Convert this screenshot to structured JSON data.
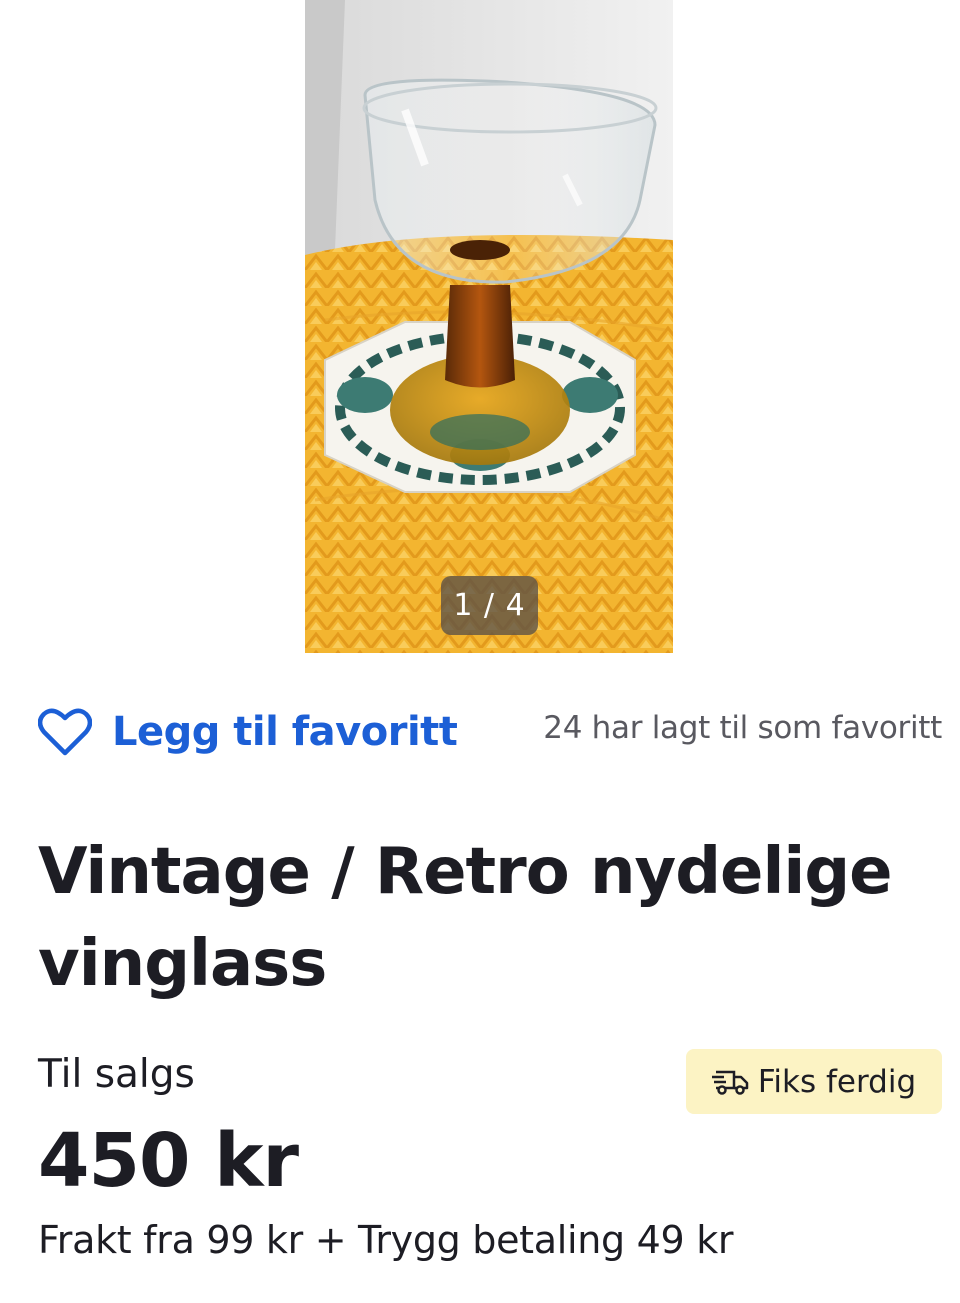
{
  "gallery": {
    "image_alt": "vintage glass photo",
    "counter": "1 / 4"
  },
  "favorite": {
    "label": "Legg til favoritt",
    "count_text": "24 har lagt til som favoritt",
    "icon": "heart-icon"
  },
  "listing": {
    "title": "Vintage / Retro nydelige vinglass",
    "status": "Til salgs",
    "price": "450 kr",
    "shipping_badge": {
      "icon": "truck-icon",
      "label": "Fiks ferdig"
    },
    "shipping_line": "Frakt fra 99 kr + Trygg betaling 49 kr"
  },
  "colors": {
    "link_blue": "#1c5fd6",
    "badge_bg": "#fcf3c4",
    "text_dark": "#1d1d24",
    "text_muted": "#595960"
  }
}
